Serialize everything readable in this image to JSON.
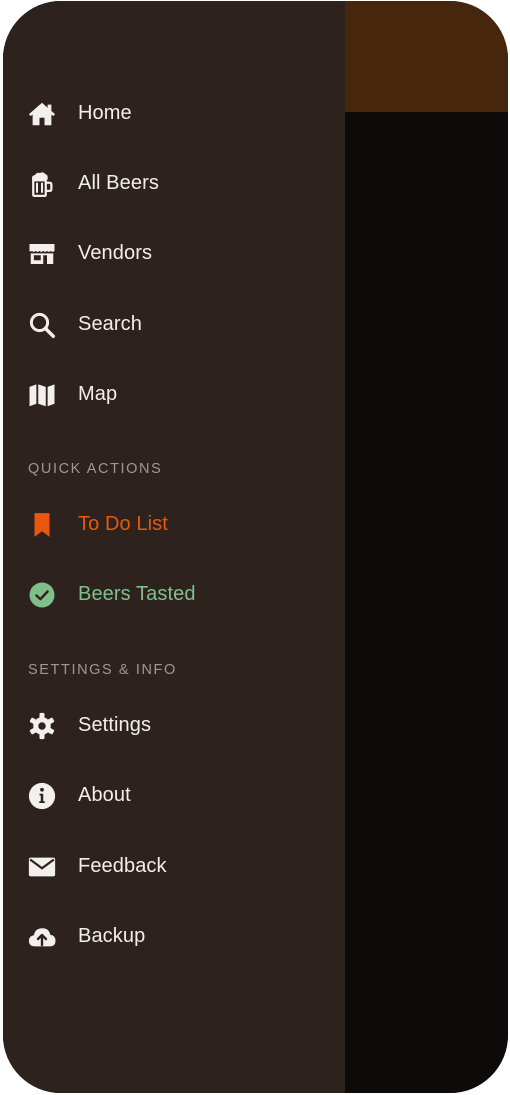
{
  "colors": {
    "drawer_bg": "#2d221e",
    "appbar": "#46260d",
    "scrim": "#0d0a09",
    "text": "#f3efed",
    "section": "#9e9895",
    "accent_orange": "#e8570f",
    "accent_green": "#7fc08a"
  },
  "nav": {
    "items": [
      {
        "label": "Home",
        "icon": "home-icon"
      },
      {
        "label": "All Beers",
        "icon": "beer-mug-icon"
      },
      {
        "label": "Vendors",
        "icon": "store-icon"
      },
      {
        "label": "Search",
        "icon": "search-icon"
      },
      {
        "label": "Map",
        "icon": "map-icon"
      }
    ]
  },
  "quick_actions": {
    "header": "QUICK ACTIONS",
    "items": [
      {
        "label": "To Do List",
        "icon": "bookmark-icon"
      },
      {
        "label": "Beers Tasted",
        "icon": "check-circle-icon"
      }
    ]
  },
  "settings_info": {
    "header": "SETTINGS & INFO",
    "items": [
      {
        "label": "Settings",
        "icon": "gear-icon"
      },
      {
        "label": "About",
        "icon": "info-icon"
      },
      {
        "label": "Feedback",
        "icon": "mail-icon"
      },
      {
        "label": "Backup",
        "icon": "cloud-upload-icon"
      }
    ]
  }
}
